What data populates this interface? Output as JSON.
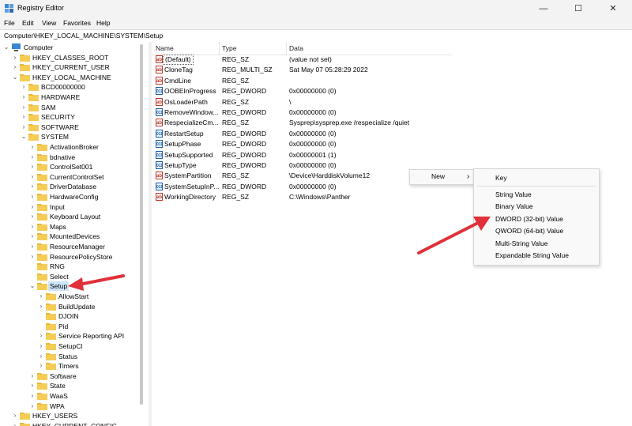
{
  "window": {
    "title": "Registry Editor",
    "minimize": "—",
    "maximize": "☐",
    "close": "✕"
  },
  "menubar": {
    "items": [
      "File",
      "Edit",
      "View",
      "Favorites",
      "Help"
    ]
  },
  "address": {
    "path": "Computer\\HKEY_LOCAL_MACHINE\\SYSTEM\\Setup"
  },
  "tree": {
    "root": "Computer",
    "hives": [
      "HKEY_CLASSES_ROOT",
      "HKEY_CURRENT_USER",
      "HKEY_LOCAL_MACHINE",
      "HKEY_USERS",
      "HKEY_CURRENT_CONFIG"
    ],
    "hklm_children": [
      "BCD00000000",
      "HARDWARE",
      "SAM",
      "SECURITY",
      "SOFTWARE",
      "SYSTEM"
    ],
    "system_children": [
      "ActivationBroker",
      "bdnative",
      "ControlSet001",
      "CurrentControlSet",
      "DriverDatabase",
      "HardwareConfig",
      "Input",
      "Keyboard Layout",
      "Maps",
      "MountedDevices",
      "ResourceManager",
      "ResourcePolicyStore",
      "RNG",
      "Select",
      "Setup",
      "Software",
      "State",
      "WaaS",
      "WPA"
    ],
    "setup_children": [
      "AllowStart",
      "BuildUpdate",
      "DJOIN",
      "Pid",
      "Service Reporting API",
      "SetupCl",
      "Status",
      "Timers"
    ],
    "selected": "Setup"
  },
  "list": {
    "headers": {
      "name": "Name",
      "type": "Type",
      "data": "Data"
    },
    "rows": [
      {
        "icon": "ab",
        "name": "(Default)",
        "type": "REG_SZ",
        "data": "(value not set)"
      },
      {
        "icon": "ab",
        "name": "CloneTag",
        "type": "REG_MULTI_SZ",
        "data": "Sat May 07 05:28:29 2022"
      },
      {
        "icon": "ab",
        "name": "CmdLine",
        "type": "REG_SZ",
        "data": ""
      },
      {
        "icon": "011",
        "name": "OOBEInProgress",
        "type": "REG_DWORD",
        "data": "0x00000000 (0)"
      },
      {
        "icon": "ab",
        "name": "OsLoaderPath",
        "type": "REG_SZ",
        "data": "\\"
      },
      {
        "icon": "011",
        "name": "RemoveWindow...",
        "type": "REG_DWORD",
        "data": "0x00000000 (0)"
      },
      {
        "icon": "ab",
        "name": "RespecializeCm...",
        "type": "REG_SZ",
        "data": "Sysprep\\sysprep.exe /respecialize /quiet"
      },
      {
        "icon": "011",
        "name": "RestartSetup",
        "type": "REG_DWORD",
        "data": "0x00000000 (0)"
      },
      {
        "icon": "011",
        "name": "SetupPhase",
        "type": "REG_DWORD",
        "data": "0x00000000 (0)"
      },
      {
        "icon": "011",
        "name": "SetupSupported",
        "type": "REG_DWORD",
        "data": "0x00000001 (1)"
      },
      {
        "icon": "011",
        "name": "SetupType",
        "type": "REG_DWORD",
        "data": "0x00000000 (0)"
      },
      {
        "icon": "ab",
        "name": "SystemPartition",
        "type": "REG_SZ",
        "data": "\\Device\\HarddiskVolume12"
      },
      {
        "icon": "011",
        "name": "SystemSetupInP...",
        "type": "REG_DWORD",
        "data": "0x00000000 (0)"
      },
      {
        "icon": "ab",
        "name": "WorkingDirectory",
        "type": "REG_SZ",
        "data": "C:\\Windows\\Panther"
      }
    ]
  },
  "context_menu": {
    "new_label": "New",
    "submenu_arrow": "›",
    "submenu": [
      "Key",
      "String Value",
      "Binary Value",
      "DWORD (32-bit) Value",
      "QWORD (64-bit) Value",
      "Multi-String Value",
      "Expandable String Value"
    ]
  },
  "colors": {
    "annotation_arrow": "#e0303a",
    "folder": "#f2c94c",
    "selection": "#cce4f7"
  }
}
